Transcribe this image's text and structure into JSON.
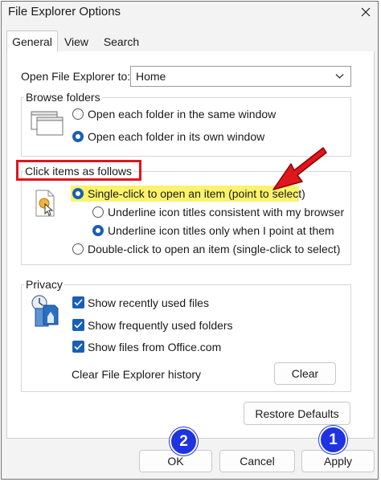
{
  "window": {
    "title": "File Explorer Options"
  },
  "tabs": [
    {
      "label": "General",
      "active": true
    },
    {
      "label": "View",
      "active": false
    },
    {
      "label": "Search",
      "active": false
    }
  ],
  "open_to": {
    "label": "Open File Explorer to:",
    "value": "Home"
  },
  "browse_folders": {
    "title": "Browse folders",
    "options": [
      {
        "label": "Open each folder in the same window",
        "checked": false
      },
      {
        "label": "Open each folder in its own window",
        "checked": true
      }
    ]
  },
  "click_items": {
    "title": "Click items as follows",
    "single_click": {
      "label": "Single-click to open an item (point to select)",
      "checked": true
    },
    "underline_browser": {
      "label": "Underline icon titles consistent with my browser",
      "checked": false
    },
    "underline_point": {
      "label": "Underline icon titles only when I point at them",
      "checked": true
    },
    "double_click": {
      "label": "Double-click to open an item (single-click to select)",
      "checked": false
    }
  },
  "privacy": {
    "title": "Privacy",
    "options": [
      {
        "label": "Show recently used files",
        "checked": true
      },
      {
        "label": "Show frequently used folders",
        "checked": true
      },
      {
        "label": "Show files from Office.com",
        "checked": true
      }
    ],
    "clear_label": "Clear File Explorer history",
    "clear_button": "Clear"
  },
  "restore_button": "Restore Defaults",
  "footer": {
    "ok": "OK",
    "cancel": "Cancel",
    "apply": "Apply"
  },
  "annotations": {
    "badge_1": "1",
    "badge_2": "2"
  },
  "colors": {
    "accent": "#1a5fb4",
    "highlight": "#fbf36c",
    "annotation_red": "#e0161d",
    "badge_blue": "#1f33e0"
  }
}
